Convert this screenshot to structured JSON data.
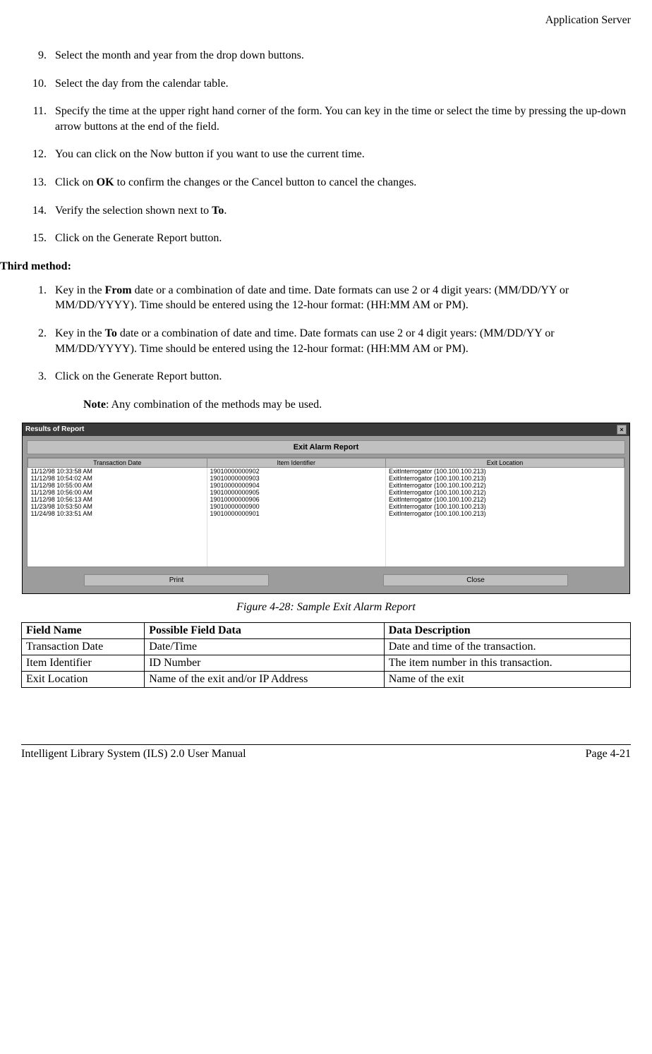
{
  "header": {
    "title": "Application Server"
  },
  "steps_primary": [
    {
      "num": "9.",
      "text": "Select the month and year from the drop down buttons."
    },
    {
      "num": "10.",
      "text": "Select the day from the calendar table."
    },
    {
      "num": "11.",
      "text": "Specify the time at the upper right hand corner of the form. You can key in the time or select the time by pressing the up-down arrow buttons at the end of the field."
    },
    {
      "num": "12.",
      "text": "You can click on the Now button if you want to use the current time."
    },
    {
      "num": "13.",
      "text_pre": "Click on ",
      "bold": "OK",
      "text_post": " to confirm the changes or the Cancel button to cancel the changes."
    },
    {
      "num": "14.",
      "text_pre": "Verify the selection shown next to ",
      "bold": "To",
      "text_post": "."
    },
    {
      "num": "15.",
      "text": "Click on the Generate Report button."
    }
  ],
  "third_method_heading": "Third method:",
  "steps_third": [
    {
      "num": "1.",
      "text_pre": "Key in the ",
      "bold": "From",
      "text_post": " date or a combination of date and time. Date formats can use 2 or 4 digit years: (MM/DD/YY or MM/DD/YYYY). Time should be entered using the 12-hour format: (HH:MM AM or PM)."
    },
    {
      "num": "2.",
      "text_pre": "Key in the ",
      "bold": "To",
      "text_post": " date or a combination of date and time. Date formats can use 2 or 4 digit years: (MM/DD/YY or MM/DD/YYYY). Time should be entered using the 12-hour format: (HH:MM AM or PM)."
    },
    {
      "num": "3.",
      "text": "Click on the Generate Report button."
    }
  ],
  "note_pre": "Note",
  "note_post": ": Any combination of the methods may be used.",
  "report": {
    "window_title": "Results of Report",
    "heading": "Exit Alarm Report",
    "columns": [
      "Transaction Date",
      "Item Identifier",
      "Exit Location"
    ],
    "rows": [
      [
        "11/12/98 10:33:58 AM",
        "19010000000902",
        "ExitInterrogator (100.100.100.213)"
      ],
      [
        "11/12/98 10:54:02 AM",
        "19010000000903",
        "ExitInterrogator (100.100.100.213)"
      ],
      [
        "11/12/98 10:55:00 AM",
        "19010000000904",
        "ExitInterrogator (100.100.100.212)"
      ],
      [
        "11/12/98 10:56:00 AM",
        "19010000000905",
        "ExitInterrogator (100.100.100.212)"
      ],
      [
        "11/12/98 10:56:13 AM",
        "19010000000906",
        "ExitInterrogator (100.100.100.212)"
      ],
      [
        "11/23/98 10:53:50 AM",
        "19010000000900",
        "ExitInterrogator (100.100.100.213)"
      ],
      [
        "11/24/98 10:33:51 AM",
        "19010000000901",
        "ExitInterrogator (100.100.100.213)"
      ]
    ],
    "print_label": "Print",
    "close_label": "Close"
  },
  "figure_caption": "Figure 4-28: Sample Exit Alarm Report",
  "field_table": {
    "headers": [
      "Field Name",
      "Possible Field Data",
      "Data Description"
    ],
    "rows": [
      [
        "Transaction Date",
        "Date/Time",
        "Date and time of the transaction."
      ],
      [
        "Item Identifier",
        "ID Number",
        "The item number in this transaction."
      ],
      [
        "Exit Location",
        "Name of the exit and/or IP Address",
        "Name of the exit"
      ]
    ]
  },
  "footer": {
    "left": "Intelligent Library System (ILS) 2.0 User Manual",
    "right": "Page 4-21"
  }
}
